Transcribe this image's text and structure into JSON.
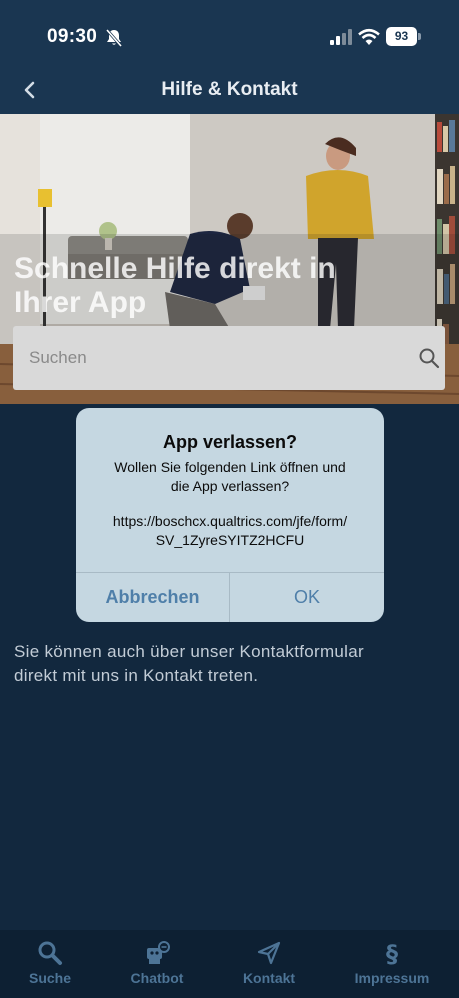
{
  "status_bar": {
    "time": "09:30",
    "battery": "93",
    "icons": [
      "bell-off-icon",
      "signal-icon",
      "wifi-icon",
      "battery-icon"
    ]
  },
  "nav": {
    "title": "Hilfe & Kontakt",
    "back_icon": "chevron-left-icon"
  },
  "hero": {
    "headline_line1": "Schnelle Hilfe direkt in",
    "headline_line2": "Ihrer App"
  },
  "search": {
    "placeholder": "Suchen",
    "icon": "search-icon"
  },
  "dialog": {
    "title": "App verlassen?",
    "message_line1": "Wollen Sie folgenden Link öffnen und",
    "message_line2": "die App verlassen?",
    "link_line1": "https://boschcx.qualtrics.com/jfe/form/",
    "link_line2": "SV_1ZyreSYITZ2HCFU",
    "cancel_label": "Abbrechen",
    "ok_label": "OK"
  },
  "contact": {
    "text_line1": "Sie können auch über unser Kontaktformular",
    "text_line2": "direkt mit uns in Kontakt treten."
  },
  "tabs": [
    {
      "label": "Suche",
      "icon": "search-icon"
    },
    {
      "label": "Chatbot",
      "icon": "chatbot-icon"
    },
    {
      "label": "Kontakt",
      "icon": "send-icon"
    },
    {
      "label": "Impressum",
      "icon": "section-sign-icon"
    }
  ],
  "colors": {
    "background": "#12283e",
    "header": "#1a3651",
    "dialog": "#c5d7e1",
    "dialog_button": "#4f7fa9",
    "tab_inactive": "#4d7496"
  }
}
